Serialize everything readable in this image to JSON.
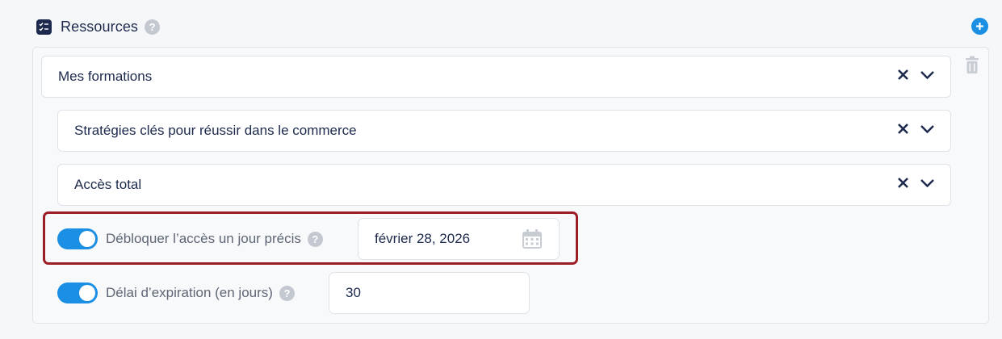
{
  "section": {
    "title": "Ressources",
    "help_glyph": "?"
  },
  "resources": [
    {
      "label": "Mes formations"
    },
    {
      "label": "Stratégies clés pour réussir dans le commerce"
    },
    {
      "label": "Accès total"
    }
  ],
  "unlock": {
    "label": "Débloquer l’accès un jour précis",
    "enabled": true,
    "date_value": "février 28, 2026"
  },
  "expiration": {
    "label": "Délai d’expiration (en jours)",
    "enabled": true,
    "value": "30"
  },
  "colors": {
    "accent": "#1a8fe3",
    "text": "#1d2a4d",
    "muted": "#5e6675",
    "highlight": "#9c1d26"
  }
}
